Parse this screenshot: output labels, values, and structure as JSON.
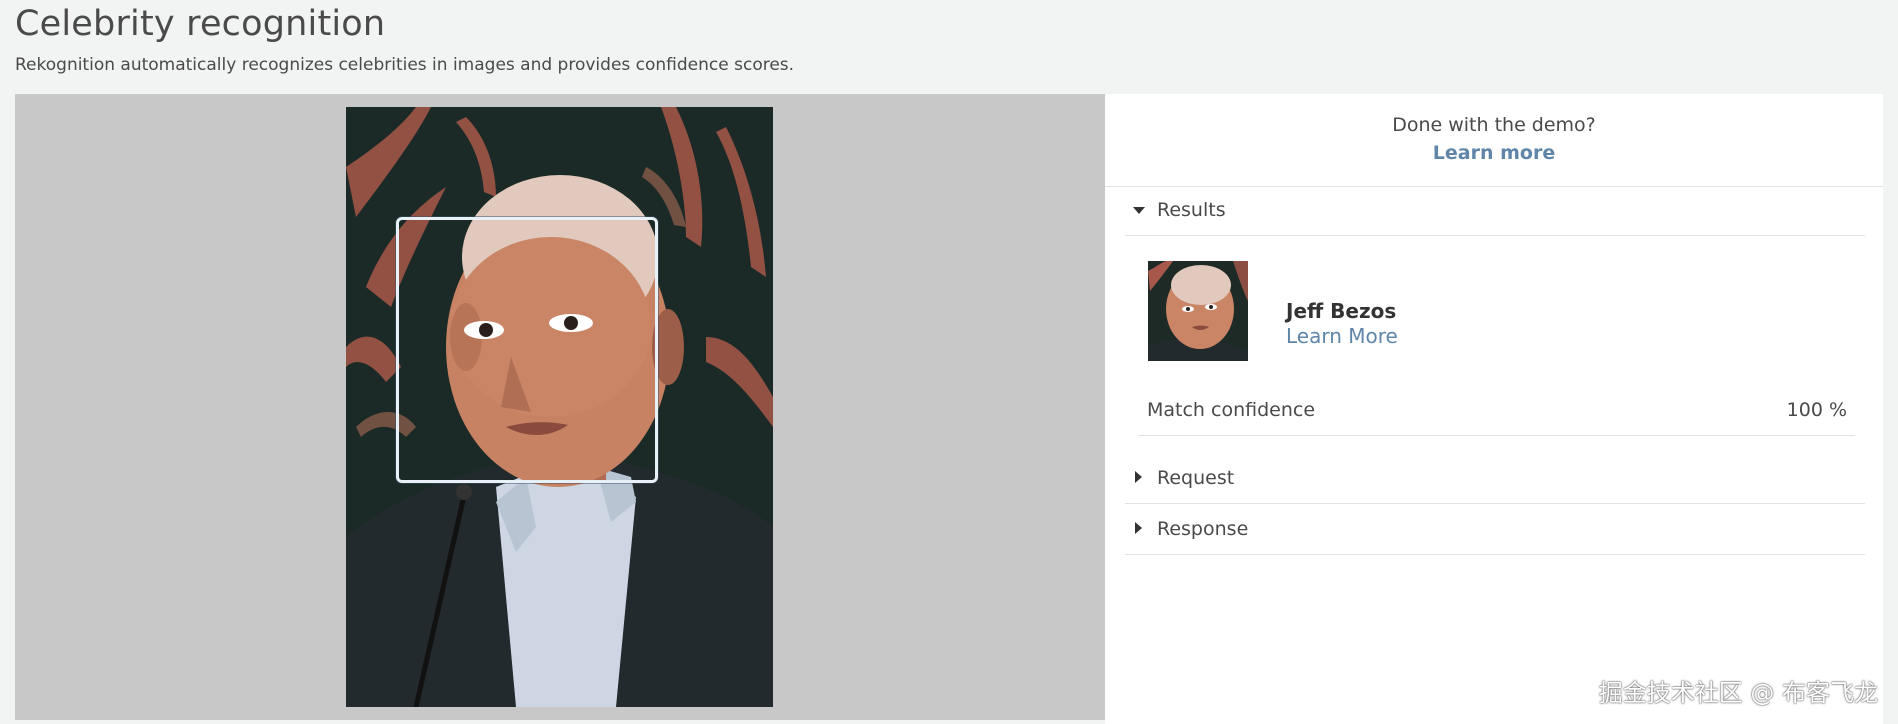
{
  "page": {
    "title": "Celebrity recognition",
    "description": "Rekognition automatically recognizes celebrities in images and provides confidence scores."
  },
  "demo": {
    "done_text": "Done with the demo?",
    "learn_more": "Learn more"
  },
  "sections": {
    "results": {
      "label": "Results",
      "expanded": true
    },
    "request": {
      "label": "Request",
      "expanded": false
    },
    "response": {
      "label": "Response",
      "expanded": false
    }
  },
  "celebrity": {
    "name": "Jeff Bezos",
    "learn_more": "Learn More",
    "confidence_label": "Match confidence",
    "confidence_value": "100 %"
  },
  "watermark": "掘金技术社区 @ 布客飞龙",
  "colors": {
    "accent_link": "#5f86a8",
    "page_bg": "#f2f3f3",
    "image_panel_bg": "#c8c8c8",
    "face_box": "#e8f1f7"
  }
}
